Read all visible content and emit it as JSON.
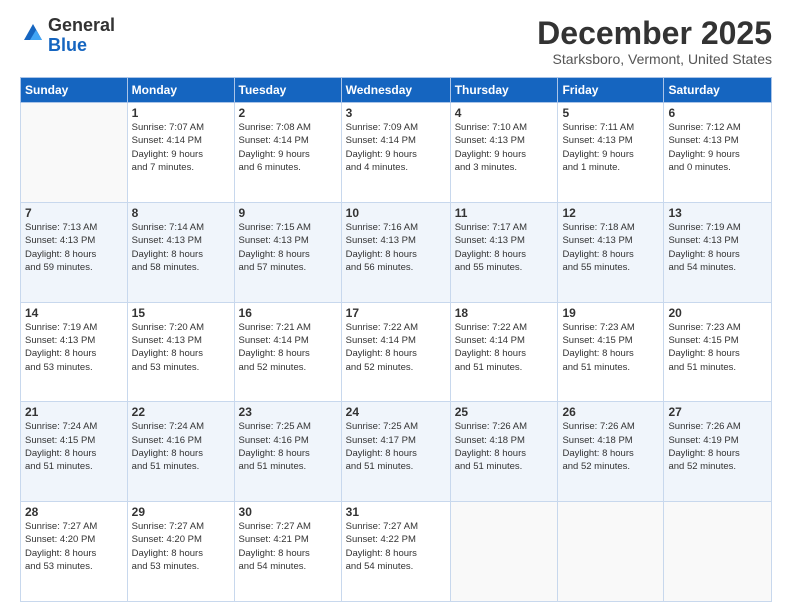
{
  "header": {
    "logo_general": "General",
    "logo_blue": "Blue",
    "month_title": "December 2025",
    "location": "Starksboro, Vermont, United States"
  },
  "days_of_week": [
    "Sunday",
    "Monday",
    "Tuesday",
    "Wednesday",
    "Thursday",
    "Friday",
    "Saturday"
  ],
  "weeks": [
    [
      {
        "day": "",
        "info": ""
      },
      {
        "day": "1",
        "info": "Sunrise: 7:07 AM\nSunset: 4:14 PM\nDaylight: 9 hours\nand 7 minutes."
      },
      {
        "day": "2",
        "info": "Sunrise: 7:08 AM\nSunset: 4:14 PM\nDaylight: 9 hours\nand 6 minutes."
      },
      {
        "day": "3",
        "info": "Sunrise: 7:09 AM\nSunset: 4:14 PM\nDaylight: 9 hours\nand 4 minutes."
      },
      {
        "day": "4",
        "info": "Sunrise: 7:10 AM\nSunset: 4:13 PM\nDaylight: 9 hours\nand 3 minutes."
      },
      {
        "day": "5",
        "info": "Sunrise: 7:11 AM\nSunset: 4:13 PM\nDaylight: 9 hours\nand 1 minute."
      },
      {
        "day": "6",
        "info": "Sunrise: 7:12 AM\nSunset: 4:13 PM\nDaylight: 9 hours\nand 0 minutes."
      }
    ],
    [
      {
        "day": "7",
        "info": "Sunrise: 7:13 AM\nSunset: 4:13 PM\nDaylight: 8 hours\nand 59 minutes."
      },
      {
        "day": "8",
        "info": "Sunrise: 7:14 AM\nSunset: 4:13 PM\nDaylight: 8 hours\nand 58 minutes."
      },
      {
        "day": "9",
        "info": "Sunrise: 7:15 AM\nSunset: 4:13 PM\nDaylight: 8 hours\nand 57 minutes."
      },
      {
        "day": "10",
        "info": "Sunrise: 7:16 AM\nSunset: 4:13 PM\nDaylight: 8 hours\nand 56 minutes."
      },
      {
        "day": "11",
        "info": "Sunrise: 7:17 AM\nSunset: 4:13 PM\nDaylight: 8 hours\nand 55 minutes."
      },
      {
        "day": "12",
        "info": "Sunrise: 7:18 AM\nSunset: 4:13 PM\nDaylight: 8 hours\nand 55 minutes."
      },
      {
        "day": "13",
        "info": "Sunrise: 7:19 AM\nSunset: 4:13 PM\nDaylight: 8 hours\nand 54 minutes."
      }
    ],
    [
      {
        "day": "14",
        "info": "Sunrise: 7:19 AM\nSunset: 4:13 PM\nDaylight: 8 hours\nand 53 minutes."
      },
      {
        "day": "15",
        "info": "Sunrise: 7:20 AM\nSunset: 4:13 PM\nDaylight: 8 hours\nand 53 minutes."
      },
      {
        "day": "16",
        "info": "Sunrise: 7:21 AM\nSunset: 4:14 PM\nDaylight: 8 hours\nand 52 minutes."
      },
      {
        "day": "17",
        "info": "Sunrise: 7:22 AM\nSunset: 4:14 PM\nDaylight: 8 hours\nand 52 minutes."
      },
      {
        "day": "18",
        "info": "Sunrise: 7:22 AM\nSunset: 4:14 PM\nDaylight: 8 hours\nand 51 minutes."
      },
      {
        "day": "19",
        "info": "Sunrise: 7:23 AM\nSunset: 4:15 PM\nDaylight: 8 hours\nand 51 minutes."
      },
      {
        "day": "20",
        "info": "Sunrise: 7:23 AM\nSunset: 4:15 PM\nDaylight: 8 hours\nand 51 minutes."
      }
    ],
    [
      {
        "day": "21",
        "info": "Sunrise: 7:24 AM\nSunset: 4:15 PM\nDaylight: 8 hours\nand 51 minutes."
      },
      {
        "day": "22",
        "info": "Sunrise: 7:24 AM\nSunset: 4:16 PM\nDaylight: 8 hours\nand 51 minutes."
      },
      {
        "day": "23",
        "info": "Sunrise: 7:25 AM\nSunset: 4:16 PM\nDaylight: 8 hours\nand 51 minutes."
      },
      {
        "day": "24",
        "info": "Sunrise: 7:25 AM\nSunset: 4:17 PM\nDaylight: 8 hours\nand 51 minutes."
      },
      {
        "day": "25",
        "info": "Sunrise: 7:26 AM\nSunset: 4:18 PM\nDaylight: 8 hours\nand 51 minutes."
      },
      {
        "day": "26",
        "info": "Sunrise: 7:26 AM\nSunset: 4:18 PM\nDaylight: 8 hours\nand 52 minutes."
      },
      {
        "day": "27",
        "info": "Sunrise: 7:26 AM\nSunset: 4:19 PM\nDaylight: 8 hours\nand 52 minutes."
      }
    ],
    [
      {
        "day": "28",
        "info": "Sunrise: 7:27 AM\nSunset: 4:20 PM\nDaylight: 8 hours\nand 53 minutes."
      },
      {
        "day": "29",
        "info": "Sunrise: 7:27 AM\nSunset: 4:20 PM\nDaylight: 8 hours\nand 53 minutes."
      },
      {
        "day": "30",
        "info": "Sunrise: 7:27 AM\nSunset: 4:21 PM\nDaylight: 8 hours\nand 54 minutes."
      },
      {
        "day": "31",
        "info": "Sunrise: 7:27 AM\nSunset: 4:22 PM\nDaylight: 8 hours\nand 54 minutes."
      },
      {
        "day": "",
        "info": ""
      },
      {
        "day": "",
        "info": ""
      },
      {
        "day": "",
        "info": ""
      }
    ]
  ]
}
